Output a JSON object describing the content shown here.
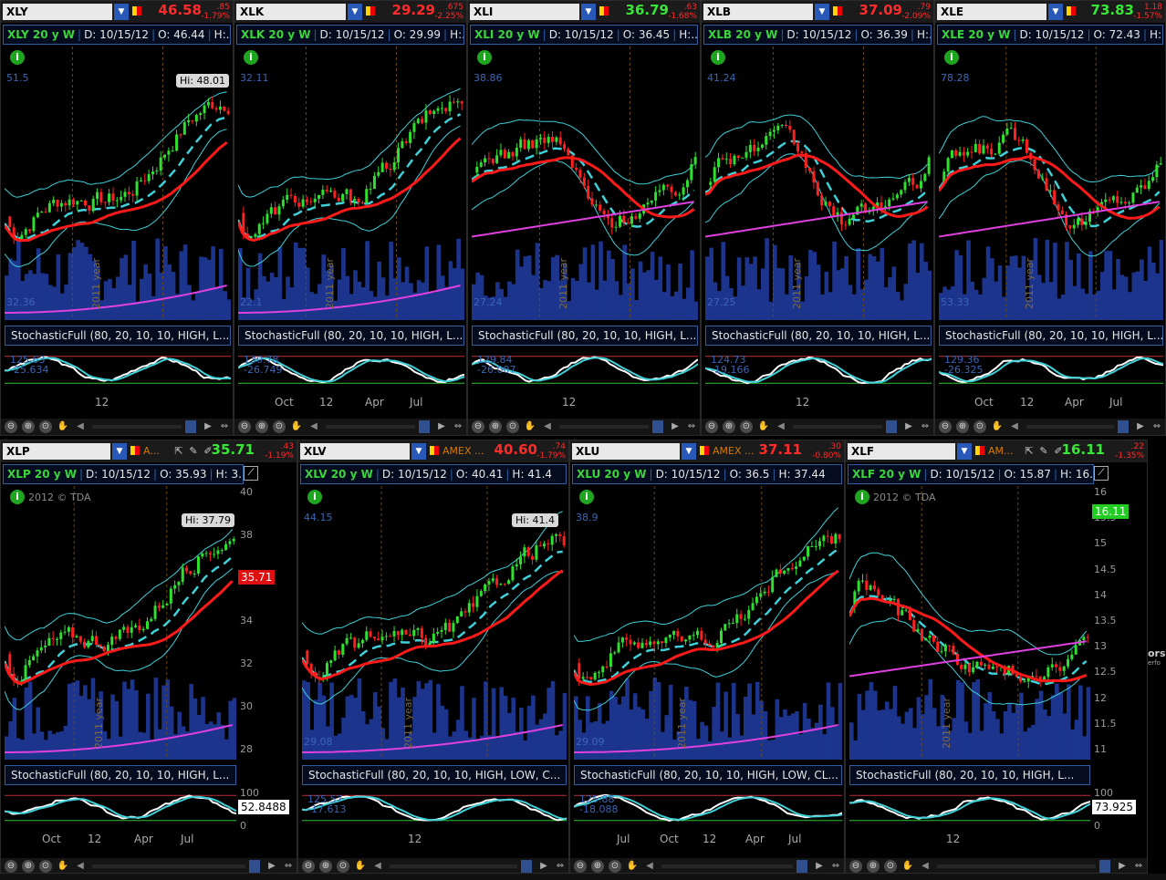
{
  "window": {
    "side_label": "ors",
    "side_sublabel": "erfo"
  },
  "panels": [
    {
      "id": "xly",
      "symbol": "XLY",
      "last": "46.58",
      "last_color": "#ff2a2a",
      "chg": ".85",
      "chg_pct": "-1.79%",
      "chg_color": "#ff2a2a",
      "info": {
        "title": "XLY 20 y W",
        "date": "D: 10/15/12",
        "open": "O: 46.44",
        "high": "H:.."
      },
      "hi_tag": "Hi: 48.01",
      "level_top": "51.5",
      "level_bottom": "32.36",
      "year_label": "2011 year",
      "stoch": "StochasticFull (80, 20, 10, 10, HIGH, L...",
      "stoch_v1": "125.63",
      "stoch_v2": "-25.634",
      "xticks": [
        "12"
      ],
      "pink": true,
      "trend": "up"
    },
    {
      "id": "xlk",
      "symbol": "XLK",
      "last": "29.29",
      "last_color": "#ff2a2a",
      "chg": ".675",
      "chg_pct": "-2.25%",
      "chg_color": "#ff2a2a",
      "info": {
        "title": "XLK 20 y W",
        "date": "D: 10/15/12",
        "open": "O: 29.99",
        "high": "H:.."
      },
      "hi_tag": "",
      "level_top": "32.11",
      "level_bottom": "22.1",
      "year_label": "2011 year",
      "stoch": "StochasticFull (80, 20, 10, 10, HIGH, L...",
      "stoch_v1": "130.78",
      "stoch_v2": "-26.749",
      "xticks": [
        "Oct",
        "12",
        "Apr",
        "Jul"
      ],
      "pink": true,
      "trend": "up"
    },
    {
      "id": "xli",
      "symbol": "XLI",
      "last": "36.79",
      "last_color": "#37e637",
      "chg": ".63",
      "chg_pct": "-1.68%",
      "chg_color": "#ff2a2a",
      "info": {
        "title": "XLI 20 y W",
        "date": "D: 10/15/12",
        "open": "O: 36.45",
        "high": "H:.."
      },
      "hi_tag": "",
      "level_top": "38.86",
      "level_bottom": "27.24",
      "year_label": "2011 year",
      "stoch": "StochasticFull (80, 20, 10, 10, HIGH, L...",
      "stoch_v1": "129.84",
      "stoch_v2": "-26.007",
      "xticks": [
        "12"
      ],
      "pink": true,
      "trend": "range"
    },
    {
      "id": "xlb",
      "symbol": "XLB",
      "last": "37.09",
      "last_color": "#ff2a2a",
      "chg": ".79",
      "chg_pct": "-2.09%",
      "chg_color": "#ff2a2a",
      "info": {
        "title": "XLB 20 y W",
        "date": "D: 10/15/12",
        "open": "O: 36.39",
        "high": "H:.."
      },
      "hi_tag": "",
      "level_top": "41.24",
      "level_bottom": "27.25",
      "year_label": "2011 year",
      "stoch": "StochasticFull (80, 20, 10, 10, HIGH, L...",
      "stoch_v1": "124.73",
      "stoch_v2": "-19.166",
      "xticks": [
        "12"
      ],
      "pink": true,
      "trend": "range"
    },
    {
      "id": "xle",
      "symbol": "XLE",
      "last": "73.83",
      "last_color": "#37e637",
      "chg": "1.18",
      "chg_pct": "-1.57%",
      "chg_color": "#ff2a2a",
      "info": {
        "title": "XLE 20 y W",
        "date": "D: 10/15/12",
        "open": "O: 72.43",
        "high": "H:.."
      },
      "hi_tag": "",
      "level_top": "78.28",
      "level_bottom": "53.33",
      "year_label": "2011 year",
      "stoch": "StochasticFull (80, 20, 10, 10, HIGH, L...",
      "stoch_v1": "129.36",
      "stoch_v2": "-26.325",
      "xticks": [
        "Oct",
        "12",
        "Apr",
        "Jul"
      ],
      "pink": true,
      "trend": "range"
    },
    {
      "id": "xlp",
      "symbol": "XLP",
      "exchange": "A...",
      "last": "35.71",
      "last_color": "#37e637",
      "chg": ".43",
      "chg_pct": "-1.19%",
      "chg_color": "#ff2a2a",
      "info": {
        "title": "XLP 20 y W",
        "date": "D: 10/15/12",
        "open": "O: 35.93",
        "high": "H: 3.."
      },
      "copyright": "2012 © TDA",
      "hi_tag": "Hi: 37.79",
      "price_tag": "35.71",
      "price_tag_color": "#e01010",
      "yaxis": [
        "40",
        "38",
        "36",
        "34",
        "32",
        "30",
        "28"
      ],
      "year_label": "2011 year",
      "stoch": "StochasticFull (80, 20, 10, 10, HIGH, L...",
      "stoch_axis": [
        "100",
        "50",
        "0"
      ],
      "stoch_tag": "52.8488",
      "xticks": [
        "Oct",
        "12",
        "Apr",
        "Jul"
      ],
      "pink": true,
      "trend": "up"
    },
    {
      "id": "xlv",
      "symbol": "XLV",
      "exchange": "AMEX ...",
      "last": "40.60",
      "last_color": "#ff2a2a",
      "chg": ".74",
      "chg_pct": "-1.79%",
      "chg_color": "#ff2a2a",
      "info": {
        "title": "XLV 20 y W",
        "date": "D: 10/15/12",
        "open": "O: 40.41",
        "high": "H: 41.4"
      },
      "hi_tag": "Hi: 41.4",
      "level_top": "44.15",
      "level_bottom": "29.08",
      "year_label": "2011 year",
      "stoch": "StochasticFull (80, 20, 10, 10, HIGH, LOW, C...",
      "stoch_v1": "125.57",
      "stoch_v2": "-17.613",
      "xticks": [
        "12"
      ],
      "pink": true,
      "trend": "up"
    },
    {
      "id": "xlu",
      "symbol": "XLU",
      "exchange": "AMEX ...",
      "last": "37.11",
      "last_color": "#ff2a2a",
      "chg": ".30",
      "chg_pct": "-0.80%",
      "chg_color": "#ff2a2a",
      "info": {
        "title": "XLU 20 y W",
        "date": "D: 10/15/12",
        "open": "O: 36.5",
        "high": "H: 37.44"
      },
      "hi_tag": "",
      "level_top": "38.9",
      "level_bottom": "29.09",
      "year_label": "2011 year",
      "stoch": "StochasticFull (80, 20, 10, 10, HIGH, LOW, CL...",
      "stoch_v1": "125.88",
      "stoch_v2": "-18.088",
      "xticks": [
        "Jul",
        "Oct",
        "12",
        "Apr",
        "Jul"
      ],
      "pink": true,
      "trend": "up"
    },
    {
      "id": "xlf",
      "symbol": "XLF",
      "exchange": "AM...",
      "last": "16.11",
      "last_color": "#37e637",
      "chg": ".22",
      "chg_pct": "-1.35%",
      "chg_color": "#ff2a2a",
      "info": {
        "title": "XLF 20 y W",
        "date": "D: 10/15/12",
        "open": "O: 15.87",
        "high": "H: 16..."
      },
      "copyright": "2012 © TDA",
      "hi_tag": "",
      "price_tag": "16.11",
      "price_tag_color": "#22cc22",
      "yaxis": [
        "16",
        "15.5",
        "15",
        "14.5",
        "14",
        "13.5",
        "13",
        "12.5",
        "12",
        "11.5",
        "11"
      ],
      "year_label": "2011 year",
      "stoch": "StochasticFull (80, 20, 10, 10, HIGH, L...",
      "stoch_axis": [
        "100",
        "50",
        "0"
      ],
      "stoch_tag": "73.925",
      "xticks": [
        "12"
      ],
      "pink": true,
      "trend": "vshape"
    }
  ]
}
